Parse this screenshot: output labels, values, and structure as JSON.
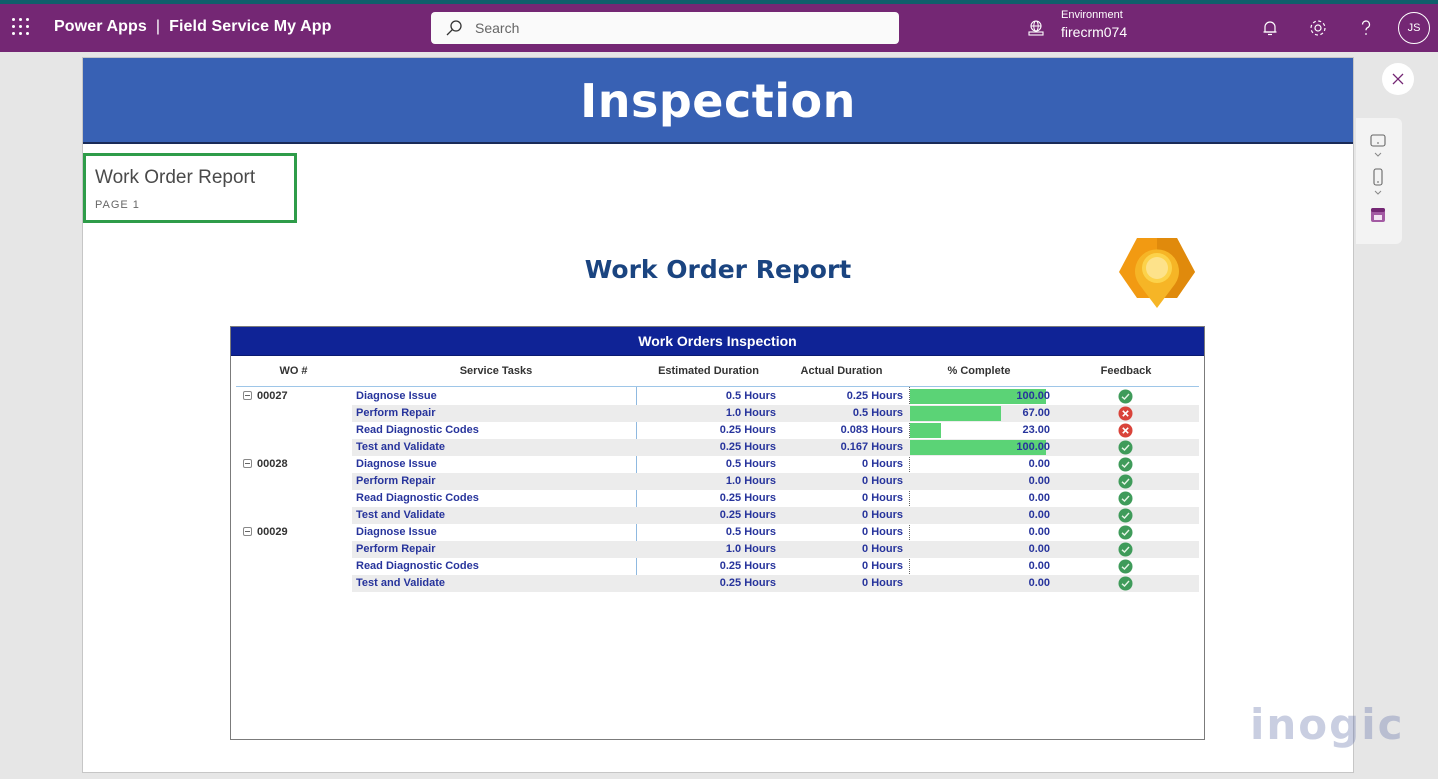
{
  "topbar": {
    "app_name": "Power Apps",
    "separator": "|",
    "app_title": "Field Service My App",
    "search_placeholder": "Search",
    "environment_label": "Environment",
    "environment_value": "firecrm074",
    "avatar_initials": "JS",
    "icons": [
      "waffle-icon",
      "search-icon",
      "environment-icon",
      "bell-icon",
      "gear-icon",
      "help-icon"
    ]
  },
  "banner": {
    "title": "Inspection"
  },
  "page_indicator": {
    "title": "Work Order Report",
    "page": "PAGE 1"
  },
  "report": {
    "title": "Work Order Report",
    "table_title": "Work Orders Inspection",
    "columns": [
      "WO #",
      "Service Tasks",
      "Estimated Duration",
      "Actual Duration",
      "% Complete",
      "Feedback"
    ],
    "rows": [
      {
        "wo": "00027",
        "task": "Diagnose Issue",
        "est": "0.5 Hours",
        "act": "0.25 Hours",
        "pct": "100.00",
        "pct_value": 100,
        "feedback": "ok"
      },
      {
        "wo": "",
        "task": "Perform Repair",
        "est": "1.0 Hours",
        "act": "0.5 Hours",
        "pct": "67.00",
        "pct_value": 67,
        "feedback": "fail"
      },
      {
        "wo": "",
        "task": "Read Diagnostic Codes",
        "est": "0.25 Hours",
        "act": "0.083 Hours",
        "pct": "23.00",
        "pct_value": 23,
        "feedback": "fail"
      },
      {
        "wo": "",
        "task": "Test and Validate",
        "est": "0.25 Hours",
        "act": "0.167 Hours",
        "pct": "100.00",
        "pct_value": 100,
        "feedback": "ok"
      },
      {
        "wo": "00028",
        "task": "Diagnose Issue",
        "est": "0.5 Hours",
        "act": "0 Hours",
        "pct": "0.00",
        "pct_value": 0,
        "feedback": "ok"
      },
      {
        "wo": "",
        "task": "Perform Repair",
        "est": "1.0 Hours",
        "act": "0 Hours",
        "pct": "0.00",
        "pct_value": 0,
        "feedback": "ok"
      },
      {
        "wo": "",
        "task": "Read Diagnostic Codes",
        "est": "0.25 Hours",
        "act": "0 Hours",
        "pct": "0.00",
        "pct_value": 0,
        "feedback": "ok"
      },
      {
        "wo": "",
        "task": "Test and Validate",
        "est": "0.25 Hours",
        "act": "0 Hours",
        "pct": "0.00",
        "pct_value": 0,
        "feedback": "ok"
      },
      {
        "wo": "00029",
        "task": "Diagnose Issue",
        "est": "0.5 Hours",
        "act": "0 Hours",
        "pct": "0.00",
        "pct_value": 0,
        "feedback": "ok"
      },
      {
        "wo": "",
        "task": "Perform Repair",
        "est": "1.0 Hours",
        "act": "0 Hours",
        "pct": "0.00",
        "pct_value": 0,
        "feedback": "ok"
      },
      {
        "wo": "",
        "task": "Read Diagnostic Codes",
        "est": "0.25 Hours",
        "act": "0 Hours",
        "pct": "0.00",
        "pct_value": 0,
        "feedback": "ok"
      },
      {
        "wo": "",
        "task": "Test and Validate",
        "est": "0.25 Hours",
        "act": "0 Hours",
        "pct": "0.00",
        "pct_value": 0,
        "feedback": "ok"
      }
    ]
  },
  "colors": {
    "topbar": "#742774",
    "banner": "#3861b4",
    "table_header": "#0f2396",
    "progress": "#5bd376",
    "ok": "#3f9b5a",
    "fail": "#d9433a",
    "page_box_border": "#2e9c49"
  },
  "watermark": "inogic"
}
